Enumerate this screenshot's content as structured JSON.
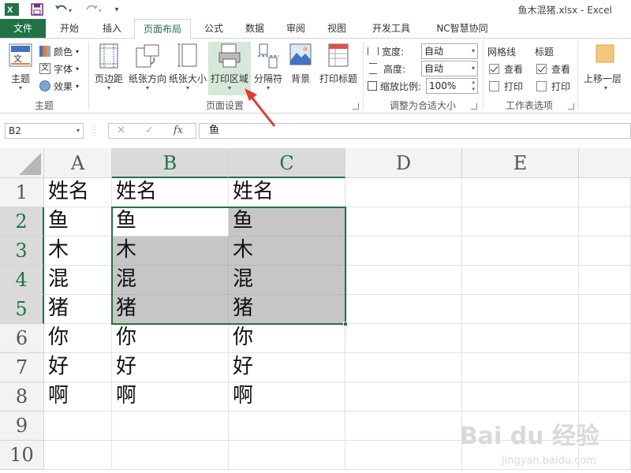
{
  "window": {
    "title": "鱼木混猪.xlsx - Excel"
  },
  "tabs": [
    {
      "label": "文件"
    },
    {
      "label": "开始"
    },
    {
      "label": "插入"
    },
    {
      "label": "页面布局"
    },
    {
      "label": "公式"
    },
    {
      "label": "数据"
    },
    {
      "label": "审阅"
    },
    {
      "label": "视图"
    },
    {
      "label": "开发工具"
    },
    {
      "label": "NC智慧协同"
    }
  ],
  "active_tab": "页面布局",
  "ribbon": {
    "theme_group": {
      "label": "主题",
      "theme_button": "主题",
      "colors": "颜色",
      "fonts": "字体",
      "effects": "效果"
    },
    "page_setup_group": {
      "label": "页面设置",
      "margins": "页边距",
      "orientation": "纸张方向",
      "size": "纸张大小",
      "print_area": "打印区域",
      "breaks": "分隔符",
      "background": "背景",
      "print_titles": "打印标题"
    },
    "scale_group": {
      "label": "调整为合适大小",
      "width_label": "宽度:",
      "width_value": "自动",
      "height_label": "高度:",
      "height_value": "自动",
      "scale_label": "缩放比例:",
      "scale_value": "100%"
    },
    "sheet_options_group": {
      "label": "工作表选项",
      "gridlines": "网格线",
      "gridlines_view": "查看",
      "gridlines_print": "打印",
      "headings": "标题",
      "headings_view": "查看",
      "headings_print": "打印"
    },
    "arrange_group": {
      "bring_forward": "上移一层"
    }
  },
  "formula_bar": {
    "name_box": "B2",
    "cancel": "✕",
    "enter": "✓",
    "fx": "fx",
    "value": "鱼"
  },
  "sheet": {
    "columns": [
      "A",
      "B",
      "C",
      "D",
      "E"
    ],
    "rows": [
      "1",
      "2",
      "3",
      "4",
      "5",
      "6",
      "7",
      "8",
      "9",
      "10"
    ],
    "cells": [
      [
        "姓名",
        "姓名",
        "姓名",
        "",
        ""
      ],
      [
        "鱼",
        "鱼",
        "鱼",
        "",
        ""
      ],
      [
        "木",
        "木",
        "木",
        "",
        ""
      ],
      [
        "混",
        "混",
        "混",
        "",
        ""
      ],
      [
        "猪",
        "猪",
        "猪",
        "",
        ""
      ],
      [
        "你",
        "你",
        "你",
        "",
        ""
      ],
      [
        "好",
        "好",
        "好",
        "",
        ""
      ],
      [
        "啊",
        "啊",
        "啊",
        "",
        ""
      ],
      [
        "",
        "",
        "",
        "",
        ""
      ],
      [
        "",
        "",
        "",
        "",
        ""
      ]
    ],
    "selection": "B2:C5"
  },
  "watermark": {
    "text": "Bai du 经验",
    "url": "jingyan.baidu.com"
  },
  "colors": {
    "excel_green": "#217346",
    "annotation_arrow": "#e53935"
  }
}
